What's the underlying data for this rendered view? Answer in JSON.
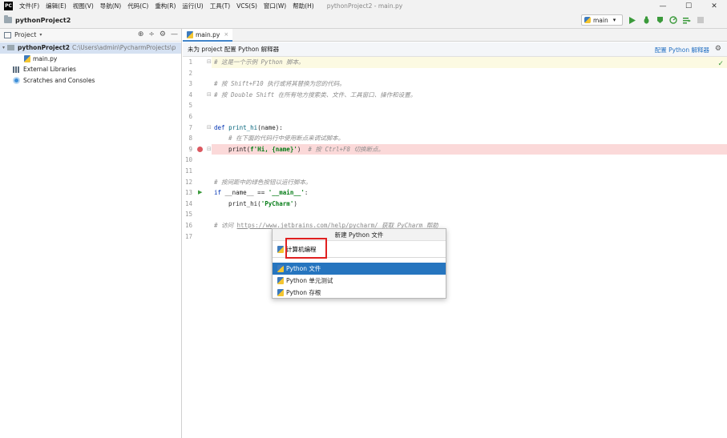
{
  "window": {
    "title": "pythonProject2 - main.py",
    "menu": [
      "文件(F)",
      "编辑(E)",
      "视图(V)",
      "导航(N)",
      "代码(C)",
      "重构(R)",
      "运行(U)",
      "工具(T)",
      "VCS(S)",
      "窗口(W)",
      "帮助(H)"
    ],
    "controls": {
      "minimize": "—",
      "maximize": "☐",
      "close": "✕"
    }
  },
  "navbar": {
    "project": "pythonProject2",
    "run_config": "main",
    "run_config_caret": "▾",
    "toolbar_icons": [
      "run-icon",
      "debug-icon",
      "coverage-icon",
      "profile-icon",
      "build-icon",
      "stop-icon"
    ]
  },
  "project_panel": {
    "title": "Project",
    "caret": "▾",
    "tools": [
      "⊕",
      "÷",
      "⚙",
      "—"
    ],
    "tree": [
      {
        "label": "pythonProject2",
        "path": "C:\\Users\\admin\\PycharmProjects\\p"
      },
      {
        "label": "main.py"
      },
      {
        "label": "External Libraries"
      },
      {
        "label": "Scratches and Consoles"
      }
    ]
  },
  "editor": {
    "tab": {
      "label": "main.py",
      "close": "×"
    },
    "banner": {
      "text": "未为 project 配置 Python 解释器",
      "link": "配置 Python 解释器"
    },
    "line_numbers": [
      "1",
      "2",
      "3",
      "4",
      "5",
      "6",
      "7",
      "8",
      "9",
      "10",
      "11",
      "12",
      "13",
      "14",
      "15",
      "16",
      "17"
    ],
    "code": {
      "l1": "# 这是一个示例 Python 脚本。",
      "l3": "# 按 Shift+F10 执行或将其替换为您的代码。",
      "l4": "# 按 Double Shift 在所有地方搜索类、文件、工具窗口、操作和设置。",
      "l7_kw": "def ",
      "l7_fn": "print_hi",
      "l7_rest": "(name):",
      "l8": "    # 在下面的代码行中使用断点来调试脚本。",
      "l9_a": "    print(",
      "l9_str": "f'Hi, {name}'",
      "l9_b": ")  ",
      "l9_comment": "# 按 Ctrl+F8 切换断点。",
      "l12": "# 按间距中的绿色按钮以运行脚本。",
      "l13_kw": "if ",
      "l13_a": "__name__ == ",
      "l13_str": "'__main__'",
      "l13_b": ":",
      "l14_a": "    print_hi(",
      "l14_str": "'PyCharm'",
      "l14_b": ")",
      "l16_a": "# 访问 ",
      "l16_link": "https://www.jetbrains.com/help/pycharm/",
      "l16_b": " 获取 PyCharm 帮助"
    }
  },
  "popup": {
    "title": "新建 Python 文件",
    "input_value": "计算机编程",
    "items": [
      "Python 文件",
      "Python 单元测试",
      "Python 存根"
    ],
    "selected_index": 0
  },
  "colors": {
    "accent": "#2675bf",
    "breakpoint": "#db5860",
    "highlight_box": "#e02020"
  }
}
